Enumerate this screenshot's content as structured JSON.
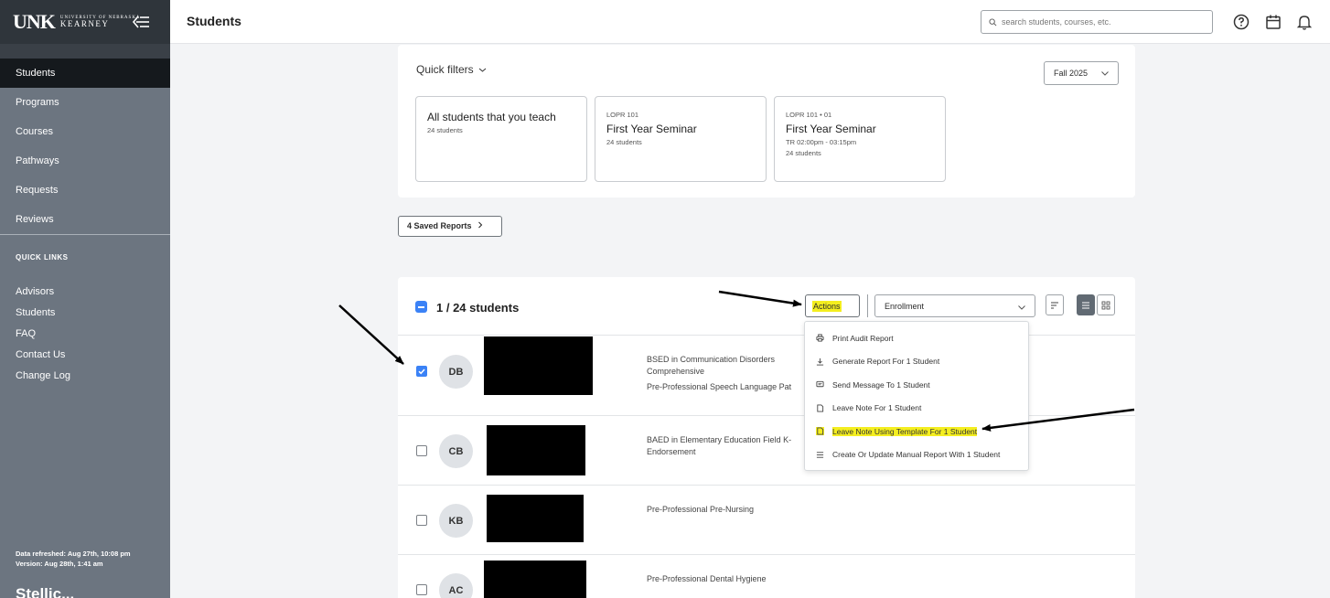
{
  "app": {
    "logo_mark": "UNK",
    "logo_small": "UNIVERSITY OF NEBRASKA",
    "logo_big": "KEARNEY",
    "page_title": "Students",
    "brand_footer": "Stellic..."
  },
  "sidebar": {
    "items": [
      {
        "label": "Students",
        "active": true
      },
      {
        "label": "Programs"
      },
      {
        "label": "Courses"
      },
      {
        "label": "Pathways"
      },
      {
        "label": "Requests"
      },
      {
        "label": "Reviews"
      }
    ],
    "quick_links_heading": "QUICK LINKS",
    "quick_links": [
      "Advisors",
      "Students",
      "FAQ",
      "Contact Us",
      "Change Log"
    ],
    "data_refreshed": "Data refreshed: Aug 27th, 10:08 pm",
    "version": "Version: Aug 28th, 1:41 am"
  },
  "header": {
    "search_placeholder": "search students, courses, etc.",
    "icons": [
      "help-icon",
      "calendar-icon",
      "bell-icon"
    ]
  },
  "quick_filters": {
    "label": "Quick filters",
    "term": "Fall 2025",
    "cards": [
      {
        "title": "All students that you teach",
        "count": "24 students"
      },
      {
        "code": "LOPR 101",
        "title": "First Year Seminar",
        "count": "24 students"
      },
      {
        "code": "LOPR 101 • 01",
        "title": "First Year Seminar",
        "time": "TR 02:00pm - 03:15pm",
        "count": "24 students"
      }
    ]
  },
  "saved_reports_label": "4 Saved Reports",
  "list": {
    "count_label": "1 / 24 students",
    "actions_label": "Actions",
    "enrollment_label": "Enrollment",
    "rows": [
      {
        "initials": "DB",
        "checked": true,
        "lines": [
          "BSED in Communication Disorders",
          "Comprehensive",
          "Pre-Professional Speech Language Pat"
        ]
      },
      {
        "initials": "CB",
        "checked": false,
        "lines": [
          "BAED in Elementary Education Field K-",
          "Endorsement"
        ]
      },
      {
        "initials": "KB",
        "checked": false,
        "lines": [
          "Pre-Professional Pre-Nursing"
        ]
      },
      {
        "initials": "AC",
        "checked": false,
        "lines": [
          "Pre-Professional Dental Hygiene"
        ]
      }
    ]
  },
  "actions_menu": {
    "items": [
      {
        "label": "Print Audit Report",
        "icon": "printer-icon"
      },
      {
        "label": "Generate Report For 1 Student",
        "icon": "download-icon"
      },
      {
        "label": "Send Message To 1 Student",
        "icon": "message-icon"
      },
      {
        "label": "Leave Note For 1 Student",
        "icon": "note-icon"
      },
      {
        "label": "Leave Note Using Template For 1 Student",
        "icon": "note-template-icon",
        "highlighted": true
      },
      {
        "label": "Create Or Update Manual Report With 1 Student",
        "icon": "list-icon"
      }
    ]
  },
  "colors": {
    "sidebar": "#6c7580",
    "sidebar_active": "#15191d",
    "accent": "#3b82f6",
    "highlight": "#f4ee1f"
  }
}
